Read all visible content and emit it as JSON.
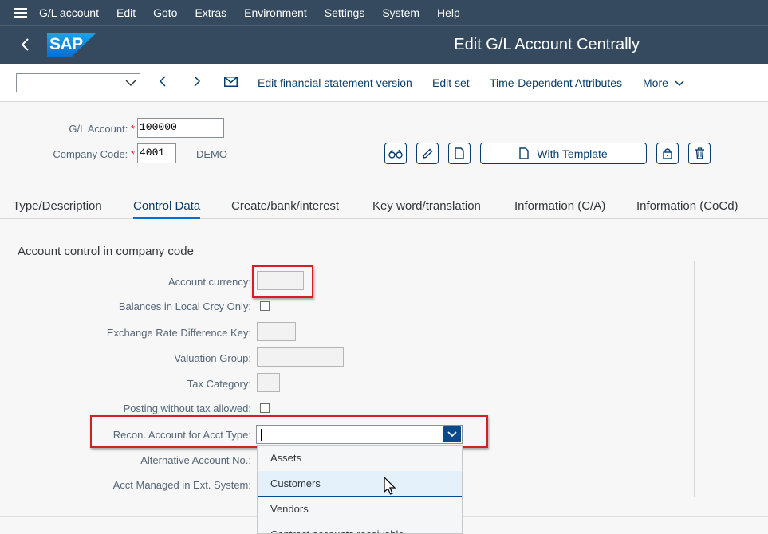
{
  "menubar": {
    "items": [
      {
        "label": "G/L account"
      },
      {
        "label": "Edit"
      },
      {
        "label": "Goto"
      },
      {
        "label": "Extras"
      },
      {
        "label": "Environment"
      },
      {
        "label": "Settings"
      },
      {
        "label": "System"
      },
      {
        "label": "Help"
      }
    ]
  },
  "header": {
    "logo_text": "SAP",
    "title": "Edit G/L Account Centrally"
  },
  "toolbar": {
    "select_value": "",
    "links": {
      "edit_fs_version": "Edit financial statement version",
      "edit_set": "Edit set",
      "time_dependent": "Time-Dependent Attributes",
      "more": "More"
    }
  },
  "fields": {
    "gl_account_label": "G/L Account:",
    "gl_account_value": "100000",
    "company_code_label": "Company Code:",
    "company_code_value": "4001",
    "company_code_desc": "DEMO",
    "required_mark": "*",
    "with_template_label": "With Template"
  },
  "tabs": [
    {
      "label": "Type/Description",
      "active": false
    },
    {
      "label": "Control Data",
      "active": true
    },
    {
      "label": "Create/bank/interest",
      "active": false
    },
    {
      "label": "Key word/translation",
      "active": false
    },
    {
      "label": "Information (C/A)",
      "active": false
    },
    {
      "label": "Information (CoCd)",
      "active": false
    }
  ],
  "group": {
    "title": "Account control in company code",
    "labels": {
      "account_currency": "Account currency:",
      "balances_local": "Balances in Local Crcy Only:",
      "exchange_rate_key": "Exchange Rate Difference Key:",
      "valuation_group": "Valuation Group:",
      "tax_category": "Tax Category:",
      "posting_without_tax": "Posting without tax allowed:",
      "recon_account": "Recon. Account for Acct Type:",
      "alt_account": "Alternative Account No.:",
      "acct_managed_ext": "Acct Managed in Ext. System:"
    }
  },
  "dropdown": {
    "options": [
      {
        "label": "Assets"
      },
      {
        "label": "Customers"
      },
      {
        "label": "Vendors"
      },
      {
        "label": "Contract accounts receivable"
      }
    ],
    "selected_index": 1
  },
  "colors": {
    "shell": "#354a5f",
    "accent": "#0a6ed1",
    "highlight_box": "#d41f26",
    "link": "#0a3d6b"
  }
}
